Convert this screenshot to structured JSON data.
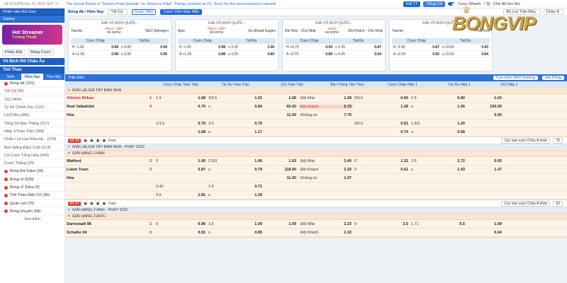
{
  "topbar": {
    "time": "08:06:42PM Feb 23, 2025 GMT +7",
    "notice": "The actual fixture is \"Santos Praia Grande -vs- America Volei\". Parlay counted as (1). Sorry for the inconvenience caused!",
    "balance": "Kết TT",
    "language": "Tiếng CN",
    "quick_bet": "Cược Nhanh",
    "odds_only": "Chế độ kèo thơ"
  },
  "logo": {
    "text": "BONGVIP"
  },
  "sidebar": {
    "tabs": [
      "Phiên bản Rút Gọn",
      "Galaxy"
    ],
    "promo": {
      "title": "Hot Streamer",
      "subtitle": "Tương Thuật"
    },
    "selectors": [
      "Phiếu Đặt",
      "Bảng Cược"
    ],
    "fav_head": "Vô Địch Nữ Châu Âu",
    "sport_head": "Thể Thao",
    "subtabs": [
      "Sớm",
      "Hôm Nay",
      "Trực tiếp"
    ],
    "items": [
      {
        "label": "Bóng đá (331)",
        "sub": false
      },
      {
        "label": "Tất Cả (56)",
        "sub": true
      },
      {
        "label": "1X2 (404)",
        "sub": true
      },
      {
        "label": "Tỷ Số Chính Xác (122)",
        "sub": true
      },
      {
        "label": "Lẻ/Chẵn (366)",
        "sub": true
      },
      {
        "label": "Tổng Số Bàn Thắng (317)",
        "sub": true
      },
      {
        "label": "Hiệp 1/Toàn Trận (288)",
        "sub": true
      },
      {
        "label": "Chẵn / Lẻ của Nửa trậ... (278)",
        "sub": true
      },
      {
        "label": "Bàn thắng Đầu/ Cuối (213)",
        "sub": true
      },
      {
        "label": "Cá Cược Tổng Hợp (443)",
        "sub": true
      },
      {
        "label": "Cược Thắng (20)",
        "sub": true
      },
      {
        "label": "Bóng Đá Saba (28)",
        "sub": false
      },
      {
        "label": "Bóng rổ (539)",
        "sub": false
      },
      {
        "label": "Bóng rổ Saba (9)",
        "sub": false
      },
      {
        "label": "Thể Thao Điện Tử (30)",
        "sub": false
      },
      {
        "label": "Quần vợt (70)",
        "sub": false
      },
      {
        "label": "Bóng chuyền (98)",
        "sub": false
      }
    ],
    "more": "Xem thêm"
  },
  "toolbar": {
    "title": "Bóng đá / Hôm Nay",
    "filter": "Tất Cả",
    "btn1": "Cược Xiên",
    "btn2": "Cược Xiên May Mắn",
    "right1": "Bộ Lọc Trận Đấu",
    "right2": "Châu Á"
  },
  "cards": [
    {
      "league": "GIẢI VÔ ĐỊCH QUỐC...",
      "home": "Twente",
      "away": "NEC Nijmegen",
      "status": "TRỰC TIẾP",
      "time": "08:30PM",
      "h_label": "Cược Chấp",
      "o_label": "Tài/Xỉu",
      "rows": [
        {
          "h": "H -1.00",
          "hv": "0.89",
          "o": "o 3.00",
          "ov": "0.90"
        },
        {
          "h": "A +1.00",
          "hv": "0.98",
          "o": "u 3.00",
          "ov": "0.95"
        }
      ]
    },
    {
      "league": "GIẢI VÔ ĐỊCH QUỐC...",
      "home": "Ajax",
      "away": "Go Ahead Eagles",
      "status": "TRỰC TIẾP",
      "time": "08:30PM",
      "h_label": "Cược Chấp",
      "o_label": "Tài/Xỉu",
      "rows": [
        {
          "h": "H -1.25",
          "hv": "0.98",
          "o": "o 3.25",
          "ov": "1.06"
        },
        {
          "h": "A +1.25",
          "hv": "0.88",
          "o": "u 3.25",
          "ov": "0.80"
        }
      ]
    },
    {
      "league": "GIẢI VÔ ĐỊCH QUỐC...",
      "home": "Đội Nhà - Chủ Nhật",
      "away": "Đội Khách - Chủ Nhật",
      "status": "02/23",
      "time": "08:30PM",
      "h_label": "Cược Chấp",
      "o_label": "Tài/Xỉu",
      "rows": [
        {
          "h": "H +3.75",
          "hv": "0.94",
          "o": "o 9.25",
          "ov": "0.87"
        },
        {
          "h": "A +3.75",
          "hv": "0.89",
          "o": "u 9.25",
          "ov": "0.94"
        }
      ]
    },
    {
      "league": "GIẢI VÔ ĐỊCH QUỐC...",
      "home": "Twente",
      "away": "Phát Góc",
      "status": "",
      "time": "",
      "h_label": "Cược Chấp",
      "o_label": "Tài/Xỉu",
      "rows": [
        {
          "h": "H -2.50",
          "hv": "0.87",
          "o": "o 10.50",
          "ov": "0.93"
        },
        {
          "h": "A +2.50",
          "hv": "0.92",
          "o": "u 10.50",
          "ov": "0.84"
        }
      ]
    }
  ],
  "grid": {
    "head": "Trận Đấu",
    "sort": "Lựa chọn bình thường",
    "view": "Hai Dòng",
    "columns": [
      "Cược Chấp Toàn Trận",
      "Tài Xỉu Toàn Trận",
      "1X2 Toàn Trận",
      "Bàn Thắng Tiếp Theo",
      "Cược Chấp Hiệp 1",
      "Tài Xỉu Hiệp 1",
      "1X2 Hiệp 1"
    ]
  },
  "leagues": [
    {
      "name": "GIẢI LALIGA TÂY BAN NHA",
      "matches": [
        {
          "home": "Athletic Bilbao",
          "away": "Real Valladolid",
          "draw": "Hòa",
          "home_score": "1",
          "away_score": "0",
          "rows": [
            [
              "1.5",
              "1.08",
              "3/3.5",
              "1.01",
              "1.06",
              "Đội Nhà",
              "1.28",
              "0/0.5",
              "0.65",
              "1.5",
              "0.80",
              "1.03"
            ],
            [
              "",
              "0.79",
              "u",
              "0.84",
              "65.00",
              "Đội Khách",
              "5.70",
              "",
              "1.28",
              "u",
              "1.05",
              "150.00"
            ],
            [
              "",
              "",
              "",
              "",
              "11.00",
              "Không có",
              "7.70",
              "",
              "",
              "",
              "",
              "0.50"
            ],
            [
              "1/1.5",
              "0.79",
              "3.0",
              "0.70",
              "",
              "",
              "",
              "0/0.5",
              "0.51",
              "1.5/2",
              "1.20",
              ""
            ],
            [
              "",
              "1.08",
              "u",
              "1.17",
              "",
              "",
              "",
              "",
              "0.74",
              "u",
              "0.68",
              ""
            ]
          ],
          "live": {
            "badge": "1H 24'",
            "label": "Fast",
            "rt1": "Các loại cược Châu Á khác",
            "rt2": "75"
          }
        }
      ]
    },
    {
      "name": "GIẢI LALIGA TÂY BAN NHA - PHẠT GÓC",
      "grey": true,
      "matches": []
    },
    {
      "name": "GIẢI HẠNG 2 ANH",
      "matches": [
        {
          "home": "Watford",
          "away": "Luton Town",
          "draw": "Hòa",
          "home_score": "2",
          "away_score": "0",
          "rows": [
            [
              "0",
              "1.00",
              "2.5/3",
              "1.06",
              "1.03",
              "Đội Nhà",
              "3.40",
              "0",
              "1.31",
              "2.5",
              "2.72",
              "0.65"
            ],
            [
              "",
              "0.87",
              "u",
              "0.79",
              "118.00",
              "Đội Khách",
              "3.20",
              "0",
              "0.61",
              "u",
              "1.43",
              "1.47"
            ],
            [
              "",
              "",
              "",
              "",
              "11.00",
              "Không có",
              "1.97",
              "",
              "",
              "",
              "",
              ""
            ],
            [
              "0.42",
              "",
              "2.5",
              "0.71",
              "",
              "",
              "",
              "",
              "",
              "",
              "",
              ""
            ],
            [
              "0.5",
              "1.81",
              "u",
              "1.16",
              "",
              "",
              "",
              "",
              "",
              "",
              "",
              ""
            ]
          ],
          "live": {
            "badge": "2H 27'",
            "label": "Fast",
            "rt1": "Các loại cược Châu Á khác",
            "rt2": "52"
          }
        }
      ]
    },
    {
      "name": "GIẢI HẠNG 2 ANH - PHẠT GÓC",
      "grey": true,
      "matches": []
    },
    {
      "name": "GIẢI HẠNG 2 ĐỨC",
      "matches": [
        {
          "home": "Darmstadt 98",
          "away": "Schalke 04",
          "draw": "",
          "home_score": "2",
          "away_score": "0",
          "rows": [
            [
              "0",
              "0.96",
              "3.5",
              "1.09",
              "1.09",
              "Đội Nhà",
              "2.23",
              "0",
              "2.5",
              "1.71",
              "0.5",
              "1.69"
            ],
            [
              "",
              "0.91",
              "u",
              "0.85",
              "",
              "Đội Khách",
              "2.33",
              "",
              "",
              "",
              "",
              "0.64"
            ]
          ],
          "live": null
        }
      ]
    }
  ]
}
